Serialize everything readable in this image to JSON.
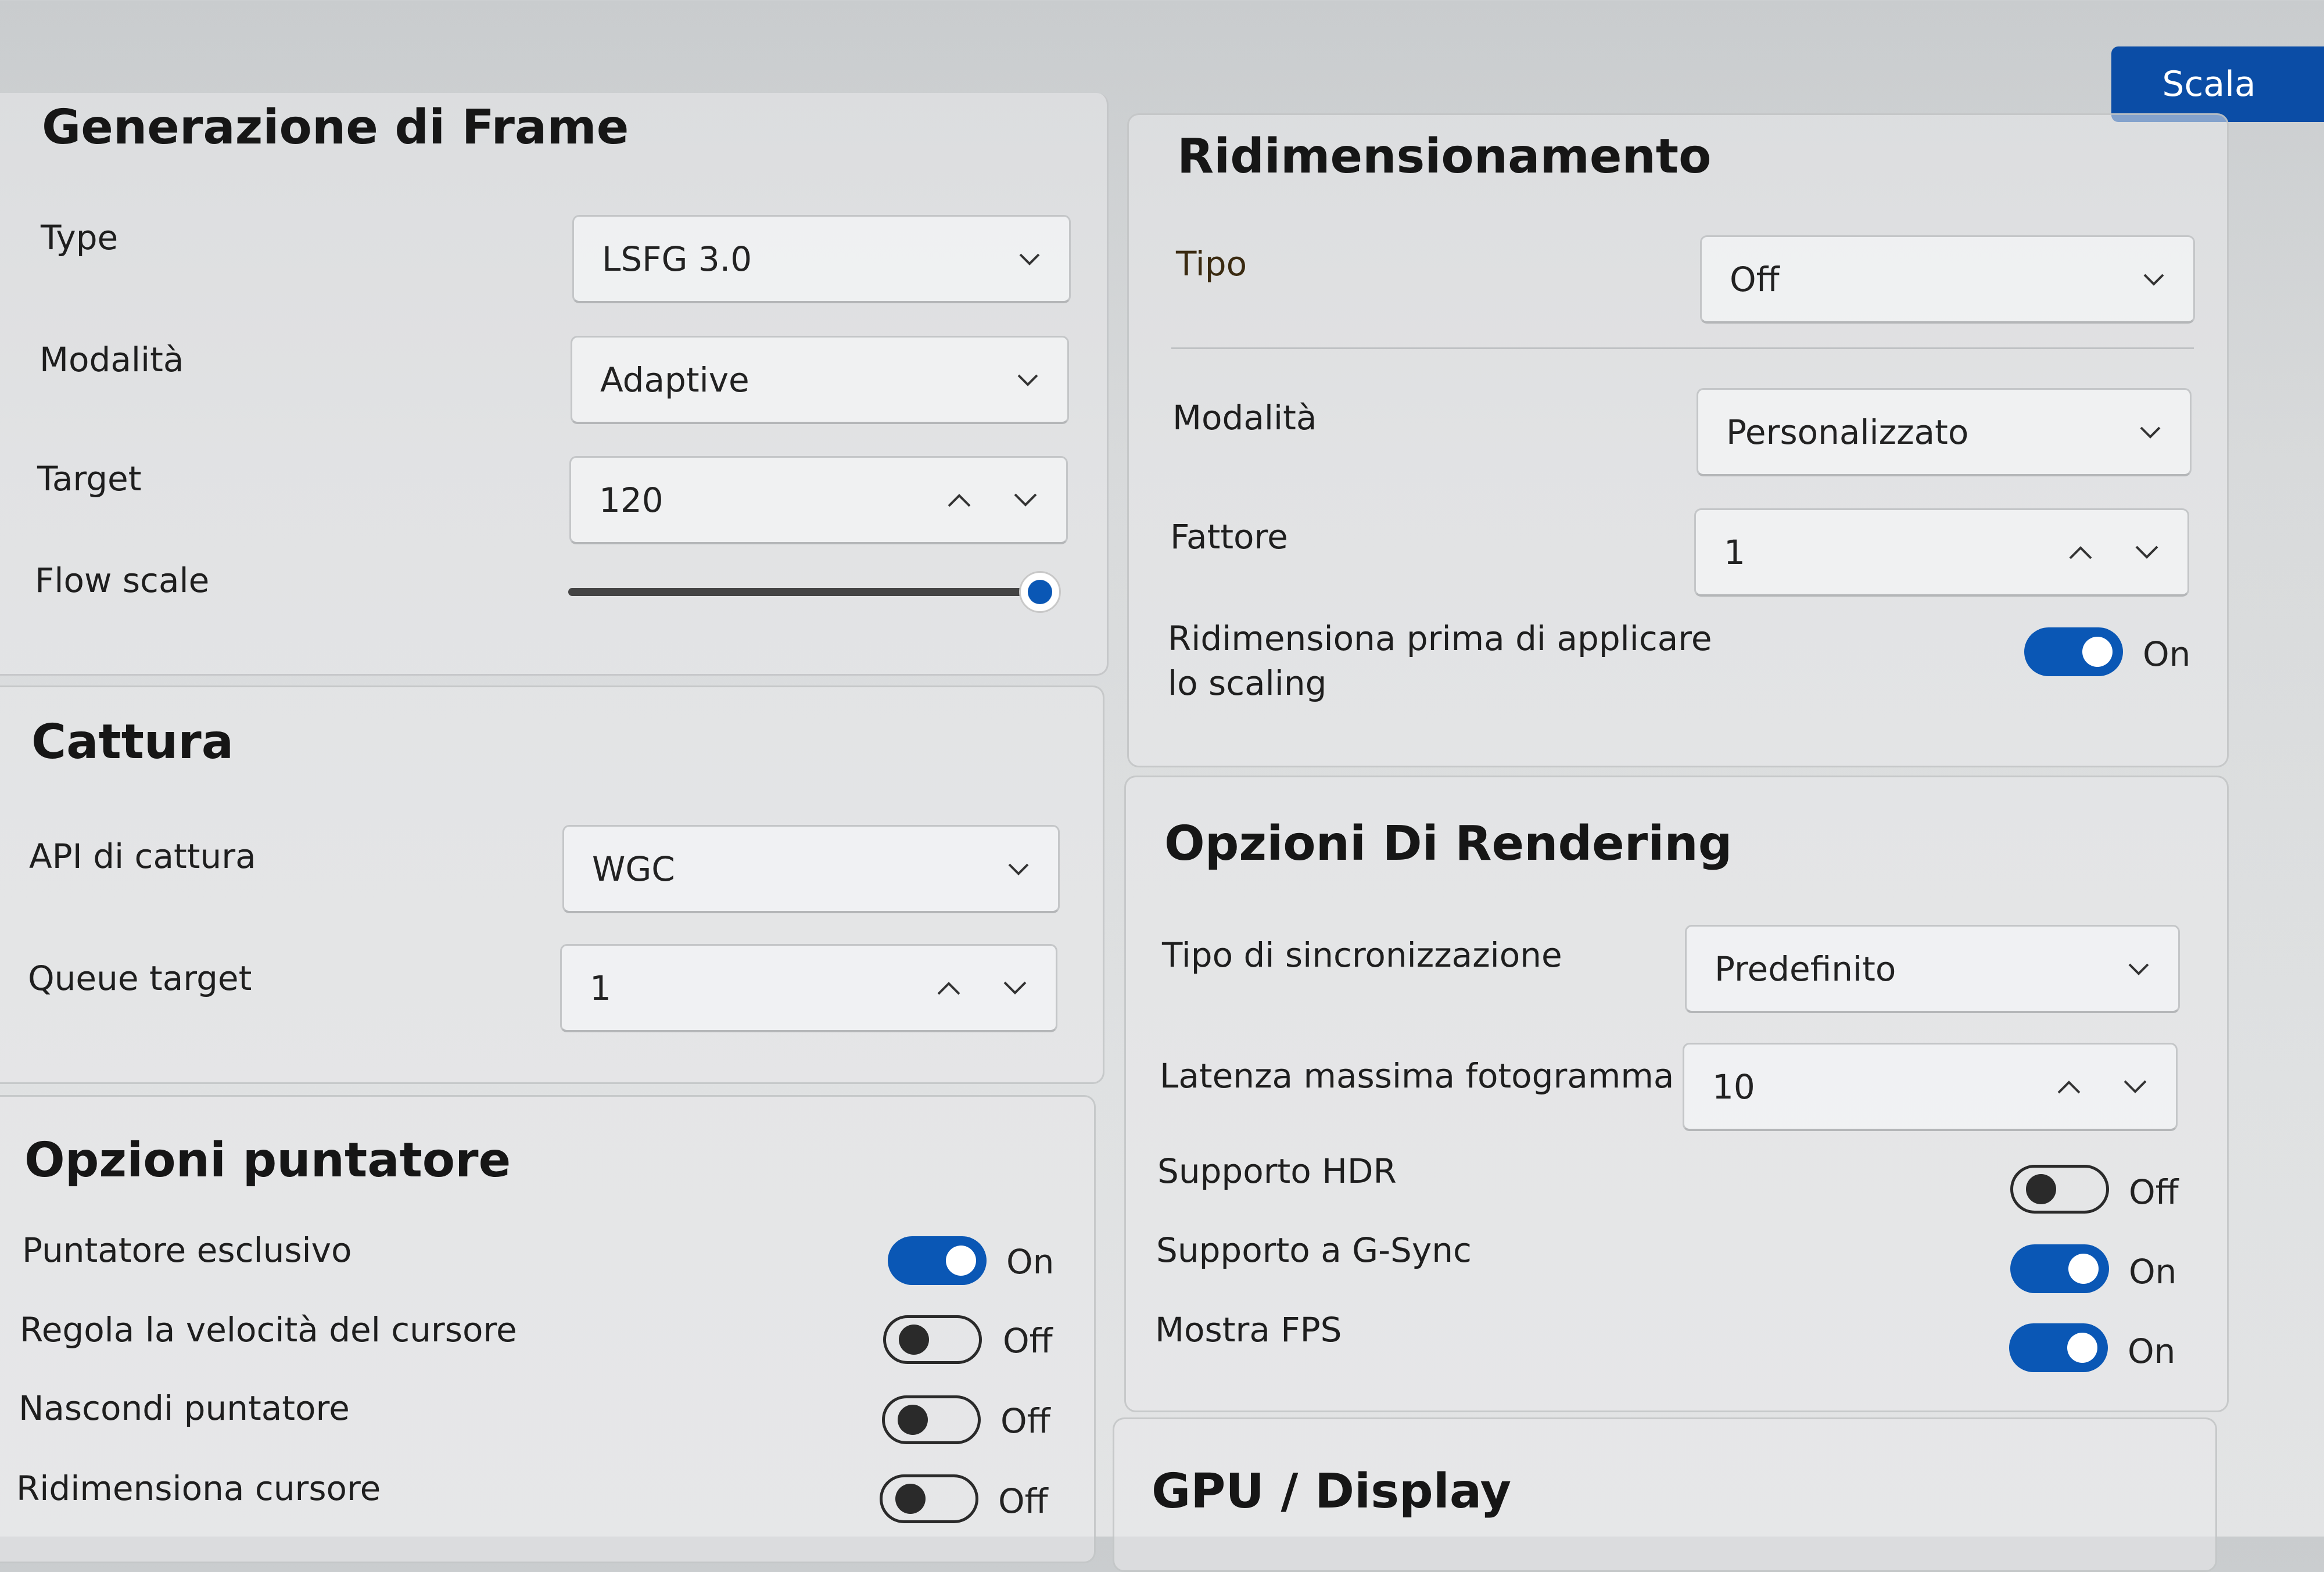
{
  "top_button": {
    "label": "Scala"
  },
  "frame_gen": {
    "title": "Generazione di Frame",
    "type": {
      "label": "Type",
      "value": "LSFG 3.0"
    },
    "mode": {
      "label": "Modalità",
      "value": "Adaptive"
    },
    "target": {
      "label": "Target",
      "value": "120"
    },
    "flow_scale": {
      "label": "Flow scale",
      "value": 1.0
    }
  },
  "capture": {
    "title": "Cattura",
    "api": {
      "label": "API di cattura",
      "value": "WGC"
    },
    "queue": {
      "label": "Queue target",
      "value": "1"
    }
  },
  "pointer": {
    "title": "Opzioni puntatore",
    "items": [
      {
        "label": "Puntatore esclusivo",
        "state": "On"
      },
      {
        "label": "Regola la velocità del cursore",
        "state": "Off"
      },
      {
        "label": "Nascondi puntatore",
        "state": "Off"
      },
      {
        "label": "Ridimensiona cursore",
        "state": "Off"
      }
    ]
  },
  "scaling": {
    "title": "Ridimensionamento",
    "type": {
      "label": "Tipo",
      "value": "Off"
    },
    "mode": {
      "label": "Modalità",
      "value": "Personalizzato"
    },
    "factor": {
      "label": "Fattore",
      "value": "1"
    },
    "resize_before": {
      "label_line1": "Ridimensiona prima di applicare",
      "label_line2": "lo scaling",
      "state": "On"
    }
  },
  "rendering": {
    "title": "Opzioni Di Rendering",
    "sync": {
      "label": "Tipo di sincronizzazione",
      "value": "Predefinito"
    },
    "latency": {
      "label": "Latenza massima fotogramma",
      "value": "10"
    },
    "hdr": {
      "label": "Supporto HDR",
      "state": "Off"
    },
    "gsync": {
      "label": "Supporto a G-Sync",
      "state": "On"
    },
    "fps": {
      "label": "Mostra FPS",
      "state": "On"
    }
  },
  "gpu": {
    "title": "GPU / Display"
  },
  "colors": {
    "accent": "#0a57b5",
    "button": "#0b4da6"
  },
  "icons": [
    "chevron-down-icon",
    "chevron-up-icon"
  ]
}
